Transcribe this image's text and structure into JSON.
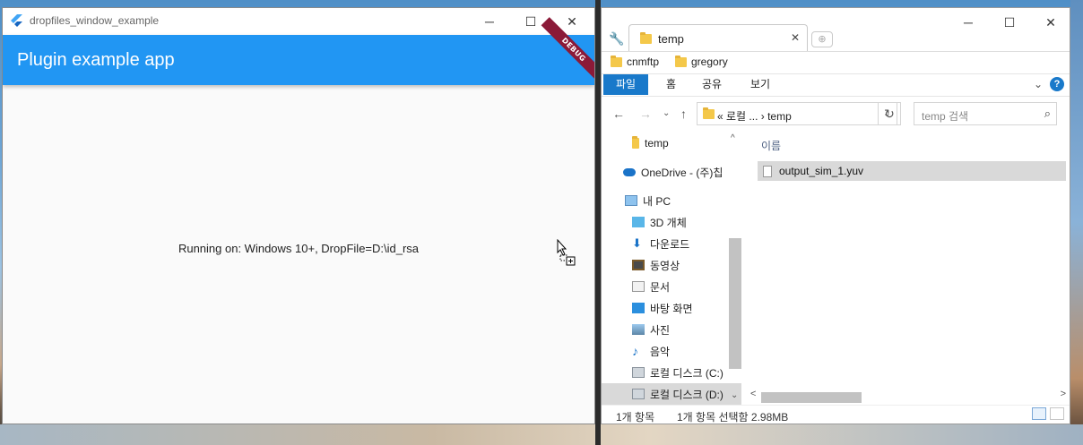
{
  "flutter_window": {
    "title": "dropfiles_window_example",
    "appbar_title": "Plugin example app",
    "debug_banner": "DEBUG",
    "body_text": "Running on: Windows 10+, DropFile=D:\\id_rsa",
    "controls": {
      "minimize": "─",
      "maximize": "☐",
      "close": "✕"
    }
  },
  "explorer_window": {
    "controls": {
      "minimize": "─",
      "maximize": "☐",
      "close": "✕"
    },
    "tab": {
      "label": "temp",
      "close": "✕",
      "new_tab": "⊕"
    },
    "bookmarks": [
      "cnmftp",
      "gregory"
    ],
    "ribbon": {
      "tabs": [
        "파일",
        "홈",
        "공유",
        "보기"
      ],
      "active": "파일",
      "expand": "⌄",
      "help": "?"
    },
    "navbar": {
      "back": "←",
      "forward": "→",
      "recent": "⌄",
      "up": "↑",
      "address": "« 로컬 ...  ›  temp",
      "address_dropdown": "⌄",
      "refresh": "↻",
      "search_placeholder": "temp 검색",
      "search_icon": "⌕"
    },
    "nav_pane": {
      "items": [
        {
          "label": "temp",
          "icon": "folder-icon"
        },
        {
          "label": "OneDrive - (주)칩",
          "icon": "cloud-icon"
        },
        {
          "label": "내 PC",
          "icon": "computer-icon"
        },
        {
          "label": "3D 개체",
          "icon": "cube-icon"
        },
        {
          "label": "다운로드",
          "icon": "download-icon"
        },
        {
          "label": "동영상",
          "icon": "video-icon"
        },
        {
          "label": "문서",
          "icon": "document-icon"
        },
        {
          "label": "바탕 화면",
          "icon": "desktop-icon"
        },
        {
          "label": "사진",
          "icon": "picture-icon"
        },
        {
          "label": "음악",
          "icon": "music-icon"
        },
        {
          "label": "로컬 디스크 (C:)",
          "icon": "drive-icon"
        },
        {
          "label": "로컬 디스크 (D:)",
          "icon": "drive-icon"
        }
      ],
      "scroll_up": "^",
      "scroll_down": "⌄"
    },
    "content": {
      "column_header": "이름",
      "files": [
        {
          "name": "output_sim_1.yuv",
          "selected": true
        }
      ],
      "scroll_left": "<",
      "scroll_right": ">"
    },
    "status": {
      "count": "1개 항목",
      "selection": "1개 항목 선택함 2.98MB"
    }
  },
  "colors": {
    "appbar": "#2196f3",
    "debug": "#8b1a38",
    "ribbon_active": "#1979ca"
  }
}
